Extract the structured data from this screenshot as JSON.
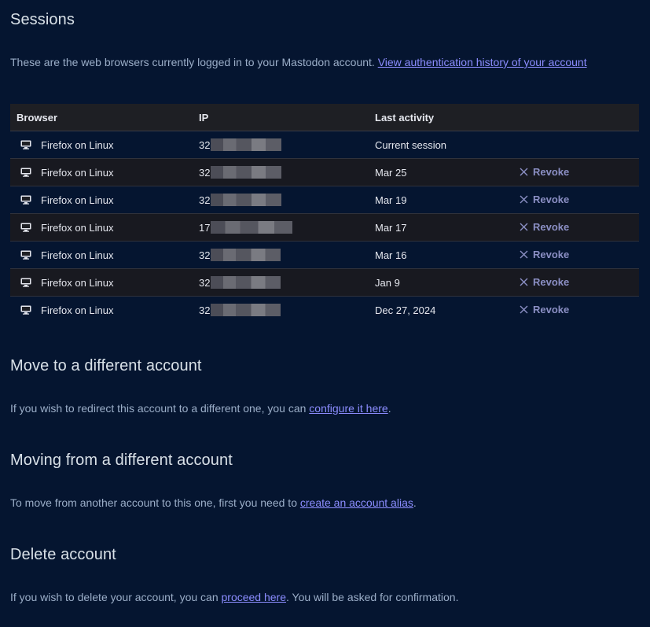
{
  "sessions": {
    "title": "Sessions",
    "description": "These are the web browsers currently logged in to your Mastodon account. ",
    "history_link": "View authentication history of your account",
    "columns": {
      "browser": "Browser",
      "ip": "IP",
      "last_activity": "Last activity"
    },
    "rows": [
      {
        "browser": "Firefox on Linux",
        "ip_prefix": "32",
        "last": "Current session",
        "action": ""
      },
      {
        "browser": "Firefox on Linux",
        "ip_prefix": "32",
        "last": "Mar 25",
        "action": "Revoke"
      },
      {
        "browser": "Firefox on Linux",
        "ip_prefix": "32",
        "last": "Mar 19",
        "action": "Revoke"
      },
      {
        "browser": "Firefox on Linux",
        "ip_prefix": "17",
        "last": "Mar 17",
        "action": "Revoke"
      },
      {
        "browser": "Firefox on Linux",
        "ip_prefix": "32",
        "last": "Mar 16",
        "action": "Revoke"
      },
      {
        "browser": "Firefox on Linux",
        "ip_prefix": "32",
        "last": "Jan 9",
        "action": "Revoke"
      },
      {
        "browser": "Firefox on Linux",
        "ip_prefix": "32",
        "last": "Dec 27, 2024",
        "action": "Revoke"
      }
    ]
  },
  "move_to": {
    "title": "Move to a different account",
    "text_before": "If you wish to redirect this account to a different one, you can ",
    "link": "configure it here",
    "text_after": "."
  },
  "moving_from": {
    "title": "Moving from a different account",
    "text_before": "To move from another account to this one, first you need to ",
    "link": "create an account alias",
    "text_after": "."
  },
  "delete": {
    "title": "Delete account",
    "text_before": "If you wish to delete your account, you can ",
    "link": "proceed here",
    "text_after": ". You will be asked for confirmation."
  },
  "icons": {
    "browser": "monitor-icon",
    "revoke": "close-icon"
  },
  "colors": {
    "background": "#051530",
    "link": "#8c8dff",
    "revoke": "#8b8fc4"
  }
}
